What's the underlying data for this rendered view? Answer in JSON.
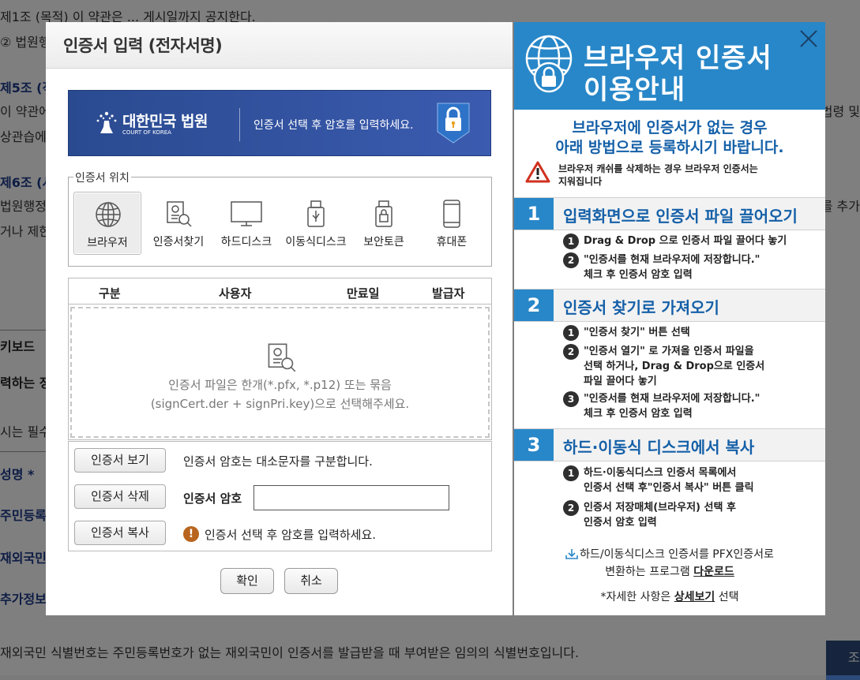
{
  "background": {
    "lines": [
      "제1조 (목적) 이 약관은 ... 게시일까지 공지한다.",
      "② 법원행",
      "제5조 (적",
      "이 약관에",
      "상관습에",
      "제6조 (서",
      "법원행정",
      "거나 제한",
      "키보드",
      "력하는 정",
      "시는 필수",
      "성명 *",
      "주민등록",
      "재외국민",
      "추가정보"
    ],
    "right_fragments": [
      "법령 및",
      "를 추가"
    ],
    "footer_note": "재외국민 식별번호는 주민등록번호가 없는 재외국민이 인증서를 발급받을 때 부여받은 임의의 식별번호입니다.",
    "corner_button": "조"
  },
  "dialog": {
    "title": "인증서 입력 (전자서명)",
    "banner": {
      "org_name": "대한민국 법원",
      "org_sub": "COURT OF KOREA",
      "message": "인증서 선택 후 암호를 입력하세요."
    },
    "location": {
      "legend": "인증서 위치",
      "options": [
        {
          "label": "브라우저",
          "icon": "globe-icon",
          "selected": true
        },
        {
          "label": "인증서찾기",
          "icon": "certificate-search-icon",
          "selected": false
        },
        {
          "label": "하드디스크",
          "icon": "monitor-icon",
          "selected": false
        },
        {
          "label": "이동식디스크",
          "icon": "usb-drive-icon",
          "selected": false
        },
        {
          "label": "보안토큰",
          "icon": "security-token-icon",
          "selected": false
        },
        {
          "label": "휴대폰",
          "icon": "mobile-phone-icon",
          "selected": false
        }
      ]
    },
    "table": {
      "columns": [
        "구분",
        "사용자",
        "만료일",
        "발급자"
      ],
      "drop_hint_line1": "인증서 파일은 한개(*.pfx, *.p12) 또는 묶음",
      "drop_hint_line2": "(signCert.der + signPri.key)으로 선택해주세요."
    },
    "controls": {
      "view_button": "인증서 보기",
      "delete_button": "인증서 삭제",
      "copy_button": "인증서 복사",
      "case_note": "인증서 암호는 대소문자를 구분합니다.",
      "password_label": "인증서 암호",
      "password_value": "",
      "status_message": "인증서 선택 후 암호를 입력하세요."
    },
    "ok_button": "확인",
    "cancel_button": "취소"
  },
  "guide": {
    "title_line1": "브라우저 인증서",
    "title_line2": "이용안내",
    "intro_line1": "브라우저에 인증서가 없는 경우",
    "intro_line2": "아래 방법으로 등록하시기 바랍니다.",
    "warning_line1": "브라우저 캐쉬를 삭제하는 경우 브라우저 인증서는",
    "warning_line2": "지워집니다",
    "sections": [
      {
        "num": "1",
        "title": "입력화면으로 인증서 파일 끌어오기",
        "steps": [
          {
            "n": "1",
            "lines": [
              "Drag & Drop 으로 인증서 파일 끌어다 놓기"
            ]
          },
          {
            "n": "2",
            "lines": [
              "\"인증서를 현재 브라우저에 저장합니다.\"",
              "체크 후 인증서 암호 입력"
            ]
          }
        ]
      },
      {
        "num": "2",
        "title": "인증서 찾기로 가져오기",
        "steps": [
          {
            "n": "1",
            "lines": [
              "\"인증서 찾기\" 버튼 선택"
            ]
          },
          {
            "n": "2",
            "lines": [
              "\"인증서 열기\" 로 가져올 인증서 파일을",
              "선택 하거나, Drag & Drop으로 인증서",
              "파일 끌어다 놓기"
            ]
          },
          {
            "n": "3",
            "lines": [
              "\"인증서를 현재 브라우저에 저장합니다.\"",
              "체크 후 인증서 암호 입력"
            ]
          }
        ]
      },
      {
        "num": "3",
        "title": "하드·이동식 디스크에서 복사",
        "steps": [
          {
            "n": "1",
            "lines": [
              "하드·이동식디스크 인증서 목록에서",
              "인증서 선택 후\"인증서 복사\" 버튼 클릭"
            ]
          },
          {
            "n": "2",
            "lines": [
              "인증서 저장매체(브라우저) 선택 후",
              "인증서 암호 입력"
            ]
          }
        ]
      }
    ],
    "download_line1": "하드/이동식디스크 인증서를 PFX인증서로",
    "download_line2_prefix": "변환하는 프로그램 ",
    "download_link": "다운로드",
    "more_prefix": "*자세한 사항은 ",
    "more_link": "상세보기",
    "more_suffix": " 선택"
  }
}
